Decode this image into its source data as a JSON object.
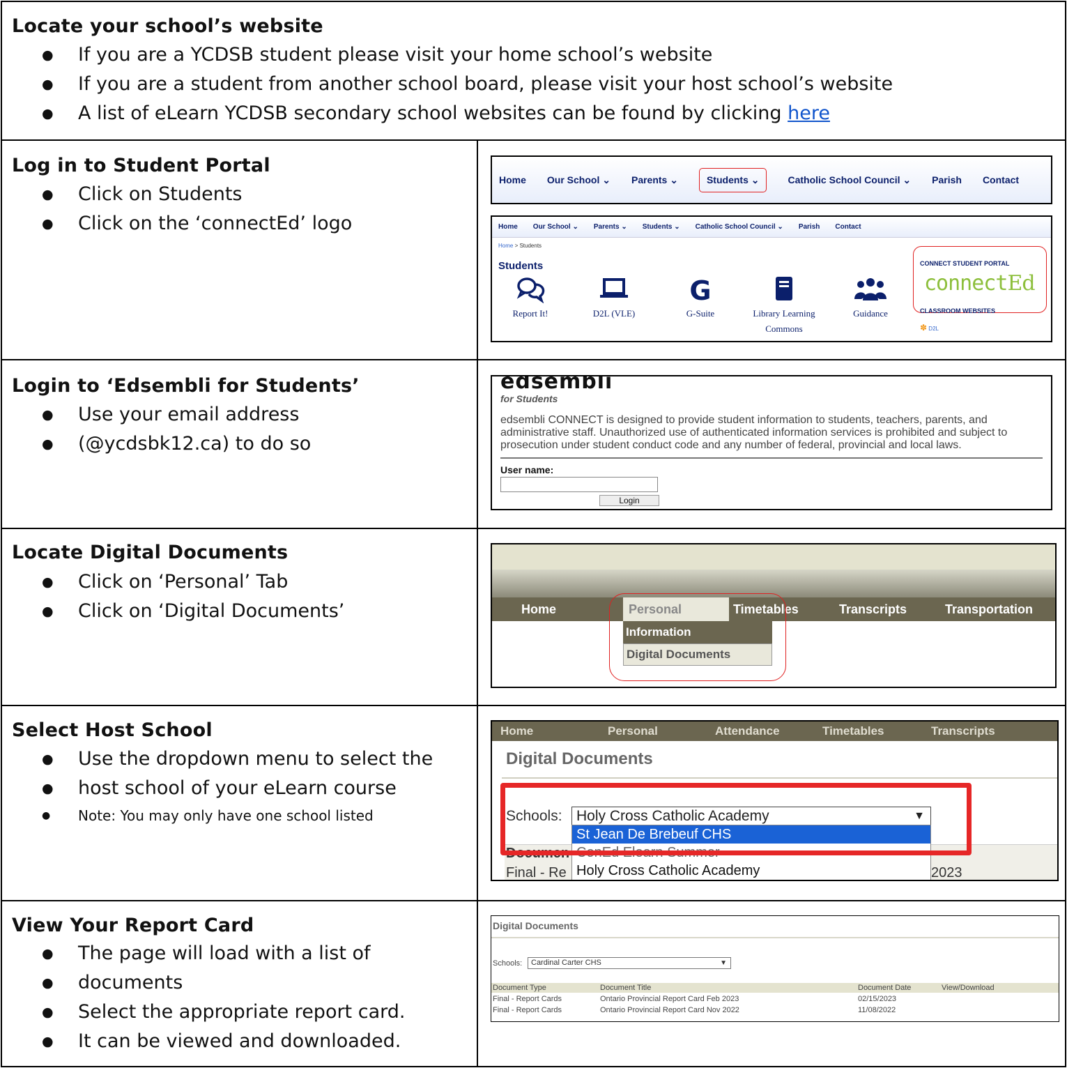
{
  "sections": [
    {
      "title": "Locate your school’s website",
      "bullets": [
        "If you are a YCDSB student please visit your home school’s website",
        "If you are a student from another school board, please visit your host school’s website"
      ],
      "bullet3_prefix": "A list of eLearn YCDSB secondary school websites can be found by clicking ",
      "bullet3_link": "here"
    },
    {
      "title": "Log in to Student Portal",
      "bullets": [
        "Click on Students",
        "Click on the ‘connectEd’ logo"
      ]
    },
    {
      "title": "Login to ‘Edsembli for Students’",
      "bullets": [
        "Use your email address",
        "(@ycdsbk12.ca) to do so"
      ]
    },
    {
      "title": "Locate Digital Documents",
      "bullets": [
        "Click on ‘Personal’ Tab",
        "Click on ‘Digital Documents’"
      ]
    },
    {
      "title": "Select Host School",
      "bullets": [
        "Use the dropdown menu to select the",
        "host school of your eLearn course"
      ],
      "note": "Note: You may only have one school listed"
    },
    {
      "title": "View Your Report Card",
      "bullets": [
        "The page will load with a list of",
        "documents",
        "Select the appropriate report card.",
        "It can be viewed and downloaded."
      ]
    }
  ],
  "shot_nav": {
    "items": [
      "Home",
      "Our School ⌄",
      "Parents ⌄",
      "Students ⌄",
      "Catholic School Council ⌄",
      "Parish",
      "Contact"
    ]
  },
  "shot_students": {
    "nav": [
      "Home",
      "Our School ⌄",
      "Parents ⌄",
      "Students ⌄",
      "Catholic School Council ⌄",
      "Parish",
      "Contact"
    ],
    "crumb_home": "Home",
    "crumb_rest": " > Students",
    "heading": "Students",
    "tiles": [
      {
        "icon": "chat-bubbles-icon",
        "glyph": "💬",
        "label": "Report It!"
      },
      {
        "icon": "laptop-icon",
        "glyph": "▭",
        "label": "D2L (VLE)"
      },
      {
        "icon": "google-g-icon",
        "glyph": "G",
        "label": "G-Suite"
      },
      {
        "icon": "book-icon",
        "glyph": "📘",
        "label": "Library Learning Commons"
      },
      {
        "icon": "users-icon",
        "glyph": "👥",
        "label": "Guidance"
      }
    ],
    "portal_label": "CONNECT STUDENT PORTAL",
    "portal_logo_a": "connect",
    "portal_logo_b": "Ed",
    "classroom_label": "CLASSROOM WEBSITES",
    "d2l": "D2L"
  },
  "shot_edsembli": {
    "logo": "edsembli",
    "tagline": "for Students",
    "description": "edsembli CONNECT is designed to provide student information to students, teachers, parents, and administrative staff. Unauthorized use of authenticated information services is prohibited and subject to prosecution under student conduct code and any number of federal, provincial and local laws.",
    "username_label": "User name:",
    "username_value": "",
    "login_button": "Login"
  },
  "shot_menu": {
    "tabs": [
      "Home",
      "Personal",
      "Timetables",
      "Transcripts",
      "Transportation"
    ],
    "menu_items": [
      "Information",
      "Digital Documents"
    ]
  },
  "shot_host": {
    "tabs": [
      "Home",
      "Personal",
      "Attendance",
      "Timetables",
      "Transcripts"
    ],
    "title": "Digital Documents",
    "schools_label": "Schools:",
    "selected": "Holy Cross Catholic Academy",
    "options": [
      "St Jean De Brebeuf CHS",
      "ConEd Elearn Summer",
      "Holy Cross Catholic Academy"
    ],
    "doc_partial": "Documen",
    "final_partial": "Final - Re",
    "year_partial": "2023"
  },
  "shot_report": {
    "title": "Digital Documents",
    "schools_label": "Schools:",
    "selected": "Cardinal Carter CHS",
    "headers": [
      "Document Type",
      "Document Title",
      "Document Date",
      "View/Download"
    ],
    "rows": [
      [
        "Final - Report Cards",
        "Ontario Provincial Report Card Feb 2023",
        "02/15/2023"
      ],
      [
        "Final - Report Cards",
        "Ontario Provincial Report Card Nov 2022",
        "11/08/2022"
      ]
    ]
  },
  "colors": {
    "border": "#000000",
    "link": "#1155cc",
    "highlight_red": "#e02020",
    "edsembli_bar": "#6b6650",
    "dropdown_selected": "#1a62d6",
    "connected_green": "#8dbf3c",
    "nav_navy": "#0b1f6b"
  }
}
